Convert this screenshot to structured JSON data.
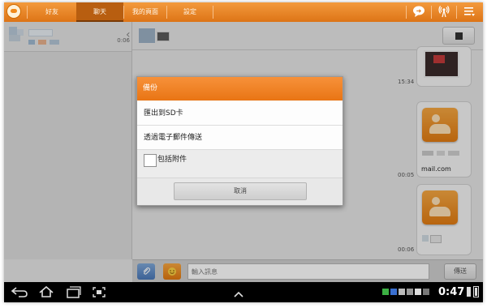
{
  "tabs": [
    {
      "label": "好友"
    },
    {
      "label": "聊天"
    },
    {
      "label": "我的頁面"
    },
    {
      "label": "設定"
    }
  ],
  "contacts": {
    "row": {
      "time": "0:06"
    }
  },
  "chat": {
    "messages": [
      {
        "time": "15:34"
      },
      {
        "time": "00:05",
        "email": "mail.com"
      },
      {
        "time": "00:06"
      }
    ]
  },
  "input_bar": {
    "placeholder": "輸入訊息",
    "send_label": "傳送"
  },
  "dialog": {
    "title": "備份",
    "options": [
      {
        "label": "匯出到SD卡"
      },
      {
        "label": "透過電子郵件傳送"
      }
    ],
    "checkbox_label": "包括附件",
    "checkbox_checked": false,
    "cancel_label": "取消"
  },
  "status_bar": {
    "clock": "0:47"
  },
  "colors": {
    "accent": "#e97514",
    "topbar": "#f39a3d"
  }
}
